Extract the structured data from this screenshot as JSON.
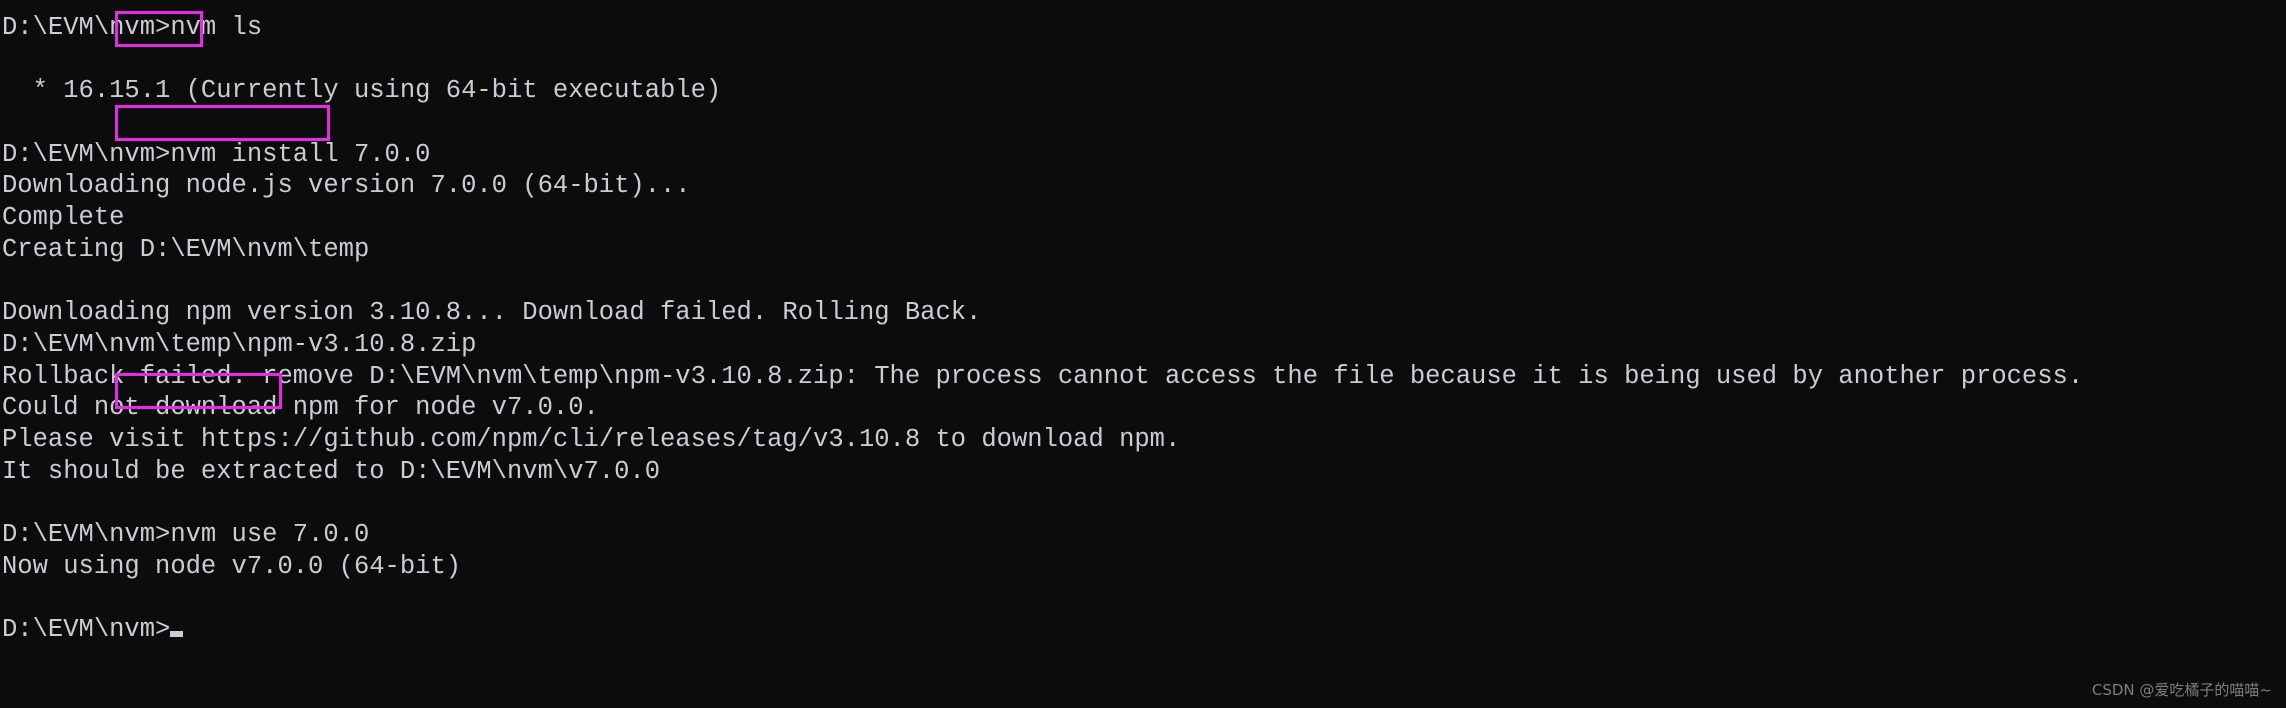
{
  "terminal": {
    "background_color": "#0c0c0c",
    "text_color": "#ccccd4",
    "highlight_color": "#e928e9",
    "prompt": "D:\\EVM\\nvm>",
    "lines": [
      {
        "id": "l0",
        "text": "D:\\EVM\\nvm>nvm ls"
      },
      {
        "id": "l1",
        "text": ""
      },
      {
        "id": "l2",
        "text": "  * 16.15.1 (Currently using 64-bit executable)"
      },
      {
        "id": "l3",
        "text": ""
      },
      {
        "id": "l4",
        "text": "D:\\EVM\\nvm>nvm install 7.0.0"
      },
      {
        "id": "l5",
        "text": "Downloading node.js version 7.0.0 (64-bit)..."
      },
      {
        "id": "l6",
        "text": "Complete"
      },
      {
        "id": "l7",
        "text": "Creating D:\\EVM\\nvm\\temp"
      },
      {
        "id": "l8",
        "text": ""
      },
      {
        "id": "l9",
        "text": "Downloading npm version 3.10.8... Download failed. Rolling Back."
      },
      {
        "id": "l10",
        "text": "D:\\EVM\\nvm\\temp\\npm-v3.10.8.zip"
      },
      {
        "id": "l11",
        "text": "Rollback failed. remove D:\\EVM\\nvm\\temp\\npm-v3.10.8.zip: The process cannot access the file because it is being used by another process."
      },
      {
        "id": "l12",
        "text": "Could not download npm for node v7.0.0."
      },
      {
        "id": "l13",
        "text": "Please visit https://github.com/npm/cli/releases/tag/v3.10.8 to download npm."
      },
      {
        "id": "l14",
        "text": "It should be extracted to D:\\EVM\\nvm\\v7.0.0"
      },
      {
        "id": "l15",
        "text": ""
      },
      {
        "id": "l16",
        "text": "D:\\EVM\\nvm>nvm use 7.0.0"
      },
      {
        "id": "l17",
        "text": "Now using node v7.0.0 (64-bit)"
      },
      {
        "id": "l18",
        "text": ""
      },
      {
        "id": "l19",
        "text": "D:\\EVM\\nvm>"
      }
    ],
    "highlighted_commands": [
      {
        "id": "hl-ls",
        "command": "nvm ls"
      },
      {
        "id": "hl-install",
        "command": "nvm install 7.0.0"
      },
      {
        "id": "hl-use",
        "command": "nvm use 7.0.0"
      }
    ]
  },
  "watermark": {
    "text": "CSDN @爱吃橘子的喵喵~"
  }
}
